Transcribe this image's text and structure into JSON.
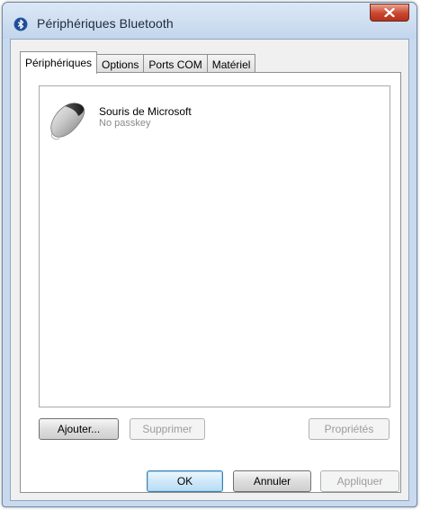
{
  "window": {
    "title": "Périphériques Bluetooth"
  },
  "tabs": [
    {
      "label": "Périphériques",
      "active": true
    },
    {
      "label": "Options",
      "active": false
    },
    {
      "label": "Ports COM",
      "active": false
    },
    {
      "label": "Matériel",
      "active": false
    }
  ],
  "devices": [
    {
      "name": "Souris de Microsoft",
      "status": "No passkey",
      "icon": "mouse-icon"
    }
  ],
  "panel_buttons": {
    "add": "Ajouter...",
    "remove": "Supprimer",
    "properties": "Propriétés"
  },
  "dialog_buttons": {
    "ok": "OK",
    "cancel": "Annuler",
    "apply": "Appliquer"
  },
  "icons": {
    "title": "bluetooth-icon",
    "close": "close-icon"
  },
  "colors": {
    "titlebar": "#c9daee",
    "close_button": "#c9462f",
    "default_button_border": "#3c7fb1",
    "disabled_text": "#9c9c9c"
  }
}
